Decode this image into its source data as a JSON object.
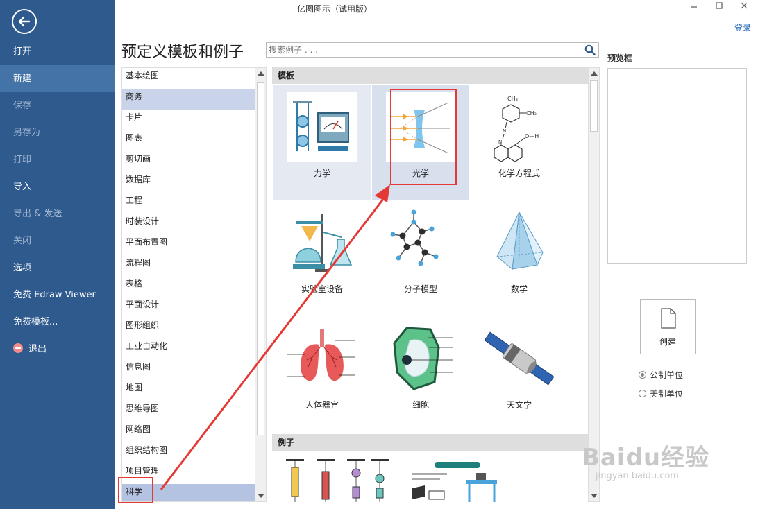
{
  "app": {
    "title": "亿图图示（试用版）",
    "login": "登录"
  },
  "sidebar": {
    "items": [
      {
        "label": "打开",
        "state": "normal"
      },
      {
        "label": "新建",
        "state": "active"
      },
      {
        "label": "保存",
        "state": "disabled"
      },
      {
        "label": "另存为",
        "state": "disabled"
      },
      {
        "label": "打印",
        "state": "disabled"
      },
      {
        "label": "导入",
        "state": "normal"
      },
      {
        "label": "导出 & 发送",
        "state": "disabled"
      },
      {
        "label": "关闭",
        "state": "disabled"
      },
      {
        "label": "选项",
        "state": "normal"
      },
      {
        "label": "免费 Edraw Viewer",
        "state": "normal"
      },
      {
        "label": "免费模板...",
        "state": "normal"
      },
      {
        "label": "退出",
        "state": "normal"
      }
    ]
  },
  "main": {
    "title": "预定义模板和例子",
    "search_placeholder": "搜索例子 . . ."
  },
  "categories": [
    "基本绘图",
    "商务",
    "卡片",
    "图表",
    "剪切画",
    "数据库",
    "工程",
    "时装设计",
    "平面布置图",
    "流程图",
    "表格",
    "平面设计",
    "图形组织",
    "工业自动化",
    "信息图",
    "地图",
    "思维导图",
    "网络图",
    "组织结构图",
    "项目管理",
    "科学"
  ],
  "gallery": {
    "templates_header": "模板",
    "examples_header": "例子",
    "templates": [
      {
        "label": "力学",
        "icon": "mechanics-icon"
      },
      {
        "label": "光学",
        "icon": "optics-icon"
      },
      {
        "label": "化学方程式",
        "icon": "chemical-equation-icon"
      },
      {
        "label": "实验室设备",
        "icon": "lab-equipment-icon"
      },
      {
        "label": "分子模型",
        "icon": "molecule-model-icon"
      },
      {
        "label": "数学",
        "icon": "math-pyramid-icon"
      },
      {
        "label": "人体器官",
        "icon": "human-organ-icon"
      },
      {
        "label": "细胞",
        "icon": "cell-icon"
      },
      {
        "label": "天文学",
        "icon": "astronomy-satellite-icon"
      }
    ],
    "chem_labels": {
      "ch3": "CH₃",
      "n": "N",
      "o_h": "O—H"
    }
  },
  "preview": {
    "label": "预览框",
    "create": "创建",
    "units": [
      {
        "label": "公制单位",
        "checked": true
      },
      {
        "label": "美制单位",
        "checked": false
      }
    ]
  },
  "watermark": {
    "brand": "Baidu经验",
    "url": "jingyan.baidu.com"
  },
  "colors": {
    "sidebar": "#2e5a8e",
    "active": "#4473a8",
    "annotation": "#e53935",
    "accent": "#1a5fb4"
  }
}
